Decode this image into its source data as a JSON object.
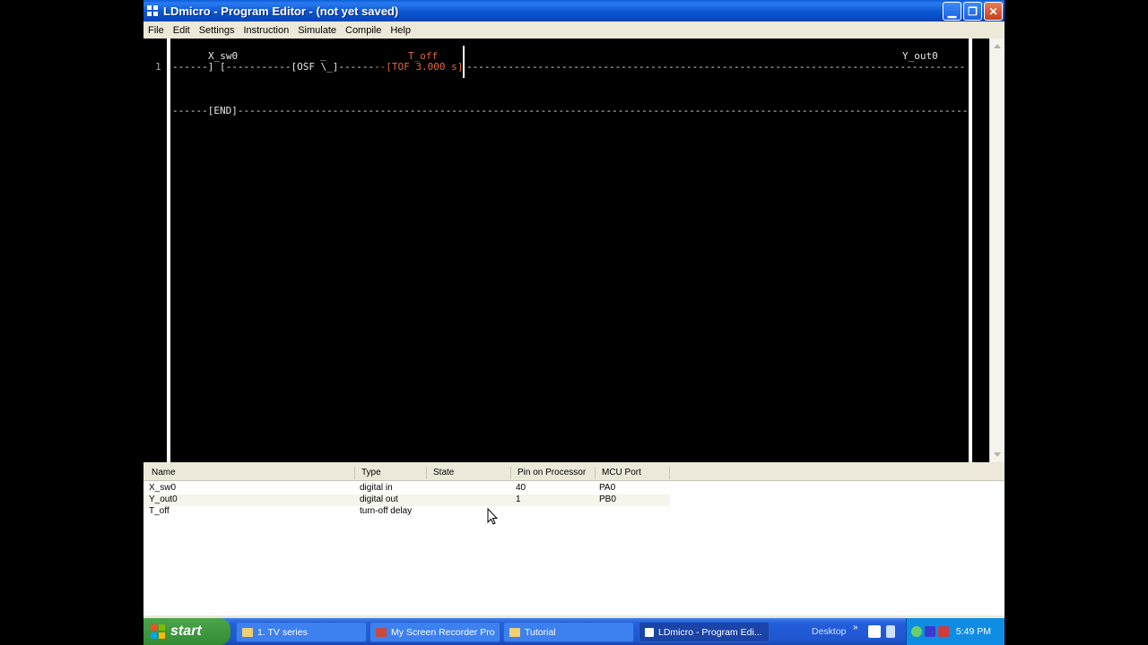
{
  "window": {
    "title": "LDmicro - Program Editor - (not yet saved)"
  },
  "menu": [
    "File",
    "Edit",
    "Settings",
    "Instruction",
    "Simulate",
    "Compile",
    "Help"
  ],
  "ladder": {
    "rung_number": "1",
    "contact_label": "X_sw0",
    "timer_label": "T_off",
    "coil_label": "Y_out0",
    "wire_lead": "------] [-----------[OSF \\_]-------",
    "osf_overline": "_",
    "timer_wire": "--[TOF 3.000 s]",
    "trail_wire": "------------------------------------------------------------------------------------------------( )----",
    "end_line": "------[END]-----------------------------------------------------------------------------------------------------------------------------------------------------"
  },
  "iolist": {
    "columns": [
      "Name",
      "Type",
      "State",
      "Pin on Processor",
      "MCU Port"
    ],
    "rows": [
      {
        "name": "X_sw0",
        "type": "digital in",
        "state": "",
        "pin": "40",
        "port": "PA0"
      },
      {
        "name": "Y_out0",
        "type": "digital out",
        "state": "",
        "pin": "1",
        "port": "PB0"
      },
      {
        "name": "T_off",
        "type": "turn-off delay",
        "state": "",
        "pin": "",
        "port": ""
      }
    ]
  },
  "taskbar": {
    "start": "start",
    "tasks": [
      "1. TV series",
      "My Screen Recorder Pro",
      "Tutorial",
      "LDmicro - Program Edi..."
    ],
    "desktop": "Desktop",
    "desktop_arrow": "»",
    "clock": "5:49 PM"
  }
}
